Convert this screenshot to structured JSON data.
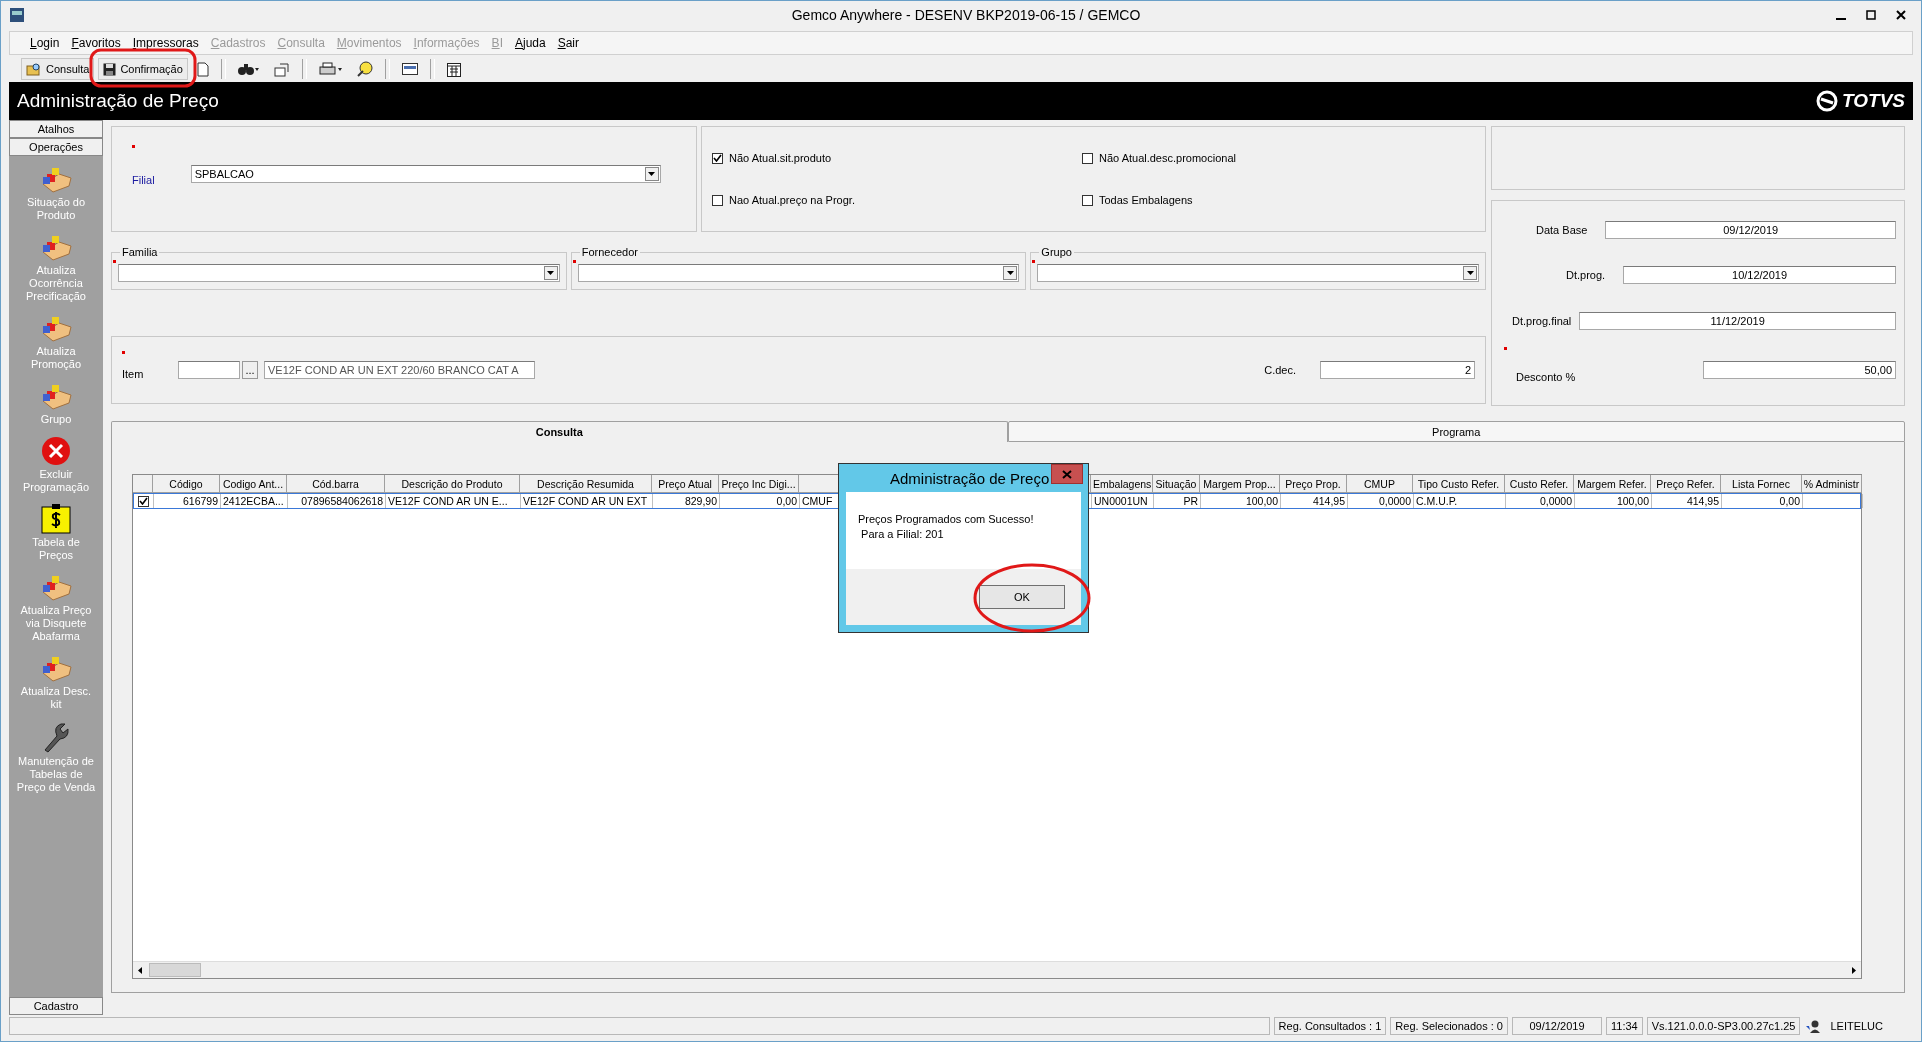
{
  "window": {
    "title": "Gemco Anywhere - DESENV BKP2019-06-15 / GEMCO"
  },
  "menu": [
    {
      "label": "Login",
      "disabled": false
    },
    {
      "label": "Favoritos",
      "disabled": false
    },
    {
      "label": "Impressoras",
      "disabled": false
    },
    {
      "label": "Cadastros",
      "disabled": true
    },
    {
      "label": "Consulta",
      "disabled": true
    },
    {
      "label": "Movimentos",
      "disabled": true
    },
    {
      "label": "Informações",
      "disabled": true
    },
    {
      "label": "BI",
      "disabled": true
    },
    {
      "label": "Ajuda",
      "disabled": false
    },
    {
      "label": "Sair",
      "disabled": false
    }
  ],
  "toolbar": [
    {
      "kind": "search",
      "label": "Consulta"
    },
    {
      "kind": "save",
      "label": "Confirmação"
    },
    {
      "kind": "new"
    },
    {
      "kind": "separator"
    },
    {
      "kind": "find"
    },
    {
      "kind": "export"
    },
    {
      "kind": "separator"
    },
    {
      "kind": "print"
    },
    {
      "kind": "help"
    },
    {
      "kind": "separator"
    },
    {
      "kind": "card"
    },
    {
      "kind": "separator"
    },
    {
      "kind": "calendar"
    }
  ],
  "header": {
    "title": "Administração de Preço",
    "logo": "TOTVS"
  },
  "sidebar": {
    "tabs": [
      "Atalhos",
      "Operações"
    ],
    "items": [
      {
        "kind": "blocks",
        "label": "Situação do\nProduto"
      },
      {
        "kind": "blocks",
        "label": "Atualiza\nOcorrência\nPrecificação"
      },
      {
        "kind": "blocks",
        "label": "Atualiza\nPromoção"
      },
      {
        "kind": "blocks",
        "label": "Grupo"
      },
      {
        "kind": "error",
        "label": "Excluir\nProgramação"
      },
      {
        "kind": "price",
        "label": "Tabela de\nPreços"
      },
      {
        "kind": "blocks",
        "label": "Atualiza Preço\nvia Disquete\nAbafarma"
      },
      {
        "kind": "blocks",
        "label": "Atualiza Desc.\nkit"
      },
      {
        "kind": "wrench",
        "label": "Manutenção de\nTabelas de\nPreço de Venda"
      }
    ],
    "bottom": "Cadastro"
  },
  "form": {
    "filial": {
      "label": "Filial",
      "value": "SPBALCAO",
      "required": true
    },
    "options": [
      {
        "label": "Não Atual.sit.produto",
        "checked": true
      },
      {
        "label": "Não Atual.desc.promocional",
        "checked": false
      },
      {
        "label": "Nao Atual.preço na Progr.",
        "checked": false
      },
      {
        "label": "Todas Embalagens",
        "checked": false
      }
    ],
    "combos": [
      {
        "label": "Familia",
        "required": true
      },
      {
        "label": "Fornecedor",
        "required": true
      },
      {
        "label": "Grupo",
        "required": true
      }
    ],
    "item": {
      "label": "Item",
      "required": true,
      "button": "...",
      "description": "VE12F COND AR UN EXT 220/60  BRANCO CAT A"
    },
    "cdec": {
      "label": "C.dec.",
      "value": "2"
    },
    "dates": [
      {
        "label": "Data Base",
        "value": "09/12/2019"
      },
      {
        "label": "Dt.prog.",
        "value": "10/12/2019"
      },
      {
        "label": "Dt.prog.final",
        "value": "11/12/2019"
      },
      {
        "label": "Desconto %",
        "value": "50,00",
        "required": true
      }
    ]
  },
  "tabs": [
    {
      "label": "Consulta",
      "selected": true
    },
    {
      "label": "Programa",
      "selected": false
    }
  ],
  "table": {
    "columns": [
      {
        "label": "Código",
        "numeric": true
      },
      {
        "label": "Codigo Ant...",
        "numeric": false
      },
      {
        "label": "Cód.barra",
        "numeric": true
      },
      {
        "label": "Descrição do Produto",
        "numeric": false
      },
      {
        "label": "Descrição Resumida",
        "numeric": false
      },
      {
        "label": "Preço Atual",
        "numeric": true
      },
      {
        "label": "Preço Inc Digi...",
        "numeric": true
      },
      {
        "numeric": false
      },
      {
        "label": "Embalagens",
        "numeric": false
      },
      {
        "label": "Situação",
        "numeric": true
      },
      {
        "label": "Margem Prop...",
        "numeric": true
      },
      {
        "label": "Preço Prop.",
        "numeric": true
      },
      {
        "label": "CMUP",
        "numeric": true
      },
      {
        "label": "Tipo Custo Refer.",
        "numeric": false
      },
      {
        "label": "Custo Refer.",
        "numeric": true
      },
      {
        "label": "Margem Refer.",
        "numeric": true
      },
      {
        "label": "Preço Refer.",
        "numeric": true
      },
      {
        "label": "Lista Fornec",
        "numeric": true
      },
      {
        "label": "% Administr"
      }
    ],
    "rows": [
      {
        "checked": true,
        "selected": true,
        "cells": [
          "616799",
          "2412ECBA...",
          "07896584062618",
          "VE12F COND AR UN E...",
          "VE12F COND AR UN EXT",
          "829,90",
          "0,00",
          "CMUF",
          "UN0001UN",
          "PR",
          "100,00",
          "414,95",
          "0,0000",
          "C.M.U.P.",
          "0,0000",
          "100,00",
          "414,95",
          "0,00"
        ]
      }
    ]
  },
  "dialog": {
    "title": "Administração de Preço",
    "message": [
      "Preços Programados com Sucesso!",
      " Para a Filial: 201"
    ],
    "button": "OK"
  },
  "status_bar": {
    "cells": [
      "Reg. Consultados : 1",
      "Reg. Selecionados : 0",
      "09/12/2019",
      "11:34",
      "Vs.121.0.0.0-SP3.00.27c1.25"
    ],
    "user": "LEITELUC"
  }
}
